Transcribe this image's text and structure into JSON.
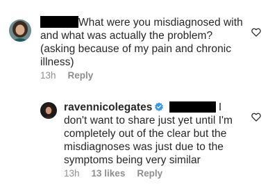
{
  "comment1": {
    "text_line1": "What were you misdiagnosed",
    "text_rest": "with and what was actually the problem? (asking because of my pain and chronic illness)",
    "time": "13h",
    "reply_label": "Reply"
  },
  "comment2": {
    "username": "ravennicolegates",
    "text_line1_tail": "I",
    "text_rest": "don't want to share just yet until I'm completely out of the clear but the misdiagnoses was just due to the symptoms being very similar",
    "time": "13h",
    "likes": "13 likes",
    "reply_label": "Reply"
  },
  "colors": {
    "text": "#262626",
    "meta": "#8e8e8e",
    "verified": "#3897f0",
    "redaction": "#000000"
  },
  "icons": [
    "heart-icon",
    "verified-badge-icon"
  ]
}
